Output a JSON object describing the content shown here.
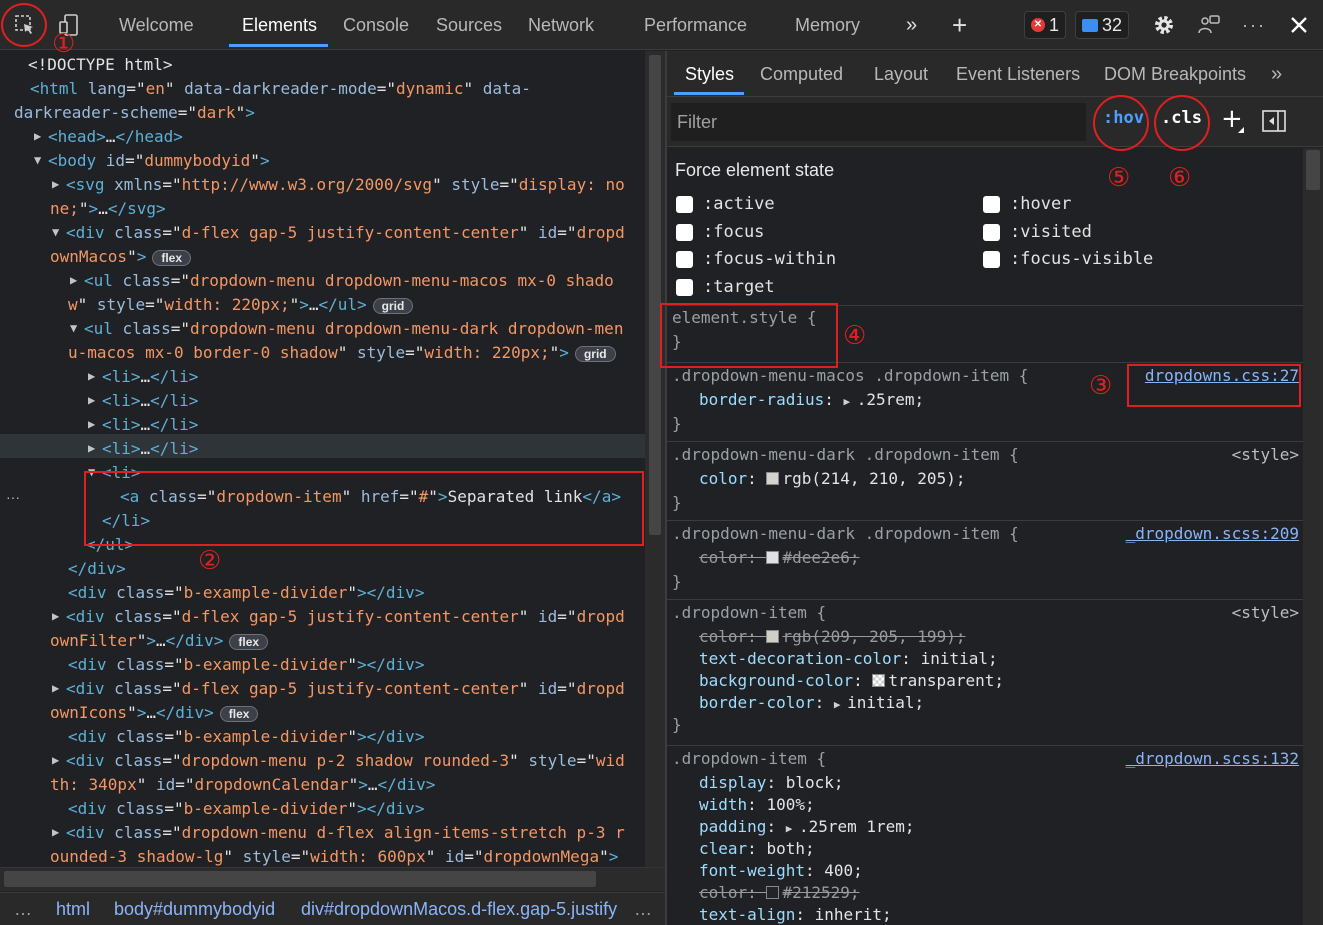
{
  "toolbar": {
    "tabs": [
      "Welcome",
      "Elements",
      "Console",
      "Sources",
      "Network",
      "Performance",
      "Memory"
    ],
    "active_tab": "Elements",
    "more_tabs": "»",
    "add_tab": "+",
    "errors_count": "1",
    "messages_count": "32",
    "icons": [
      "inspect-element-icon",
      "device-emulation-icon",
      "more-tabs-icon",
      "plus-icon",
      "error-icon",
      "message-icon",
      "gear-icon",
      "feedback-icon",
      "more-options-icon",
      "close-icon"
    ]
  },
  "dom_tree": {
    "lines": [
      {
        "indent": 28,
        "tri": "",
        "html": "<!DOCTYPE html>"
      },
      {
        "indent": 30,
        "tri": "",
        "parts": [
          [
            "tg",
            "<html "
          ],
          [
            "an",
            "lang"
          ],
          [
            "tx",
            "=\""
          ],
          [
            "av",
            "en"
          ],
          [
            "tx",
            "\" "
          ],
          [
            "an",
            "data-darkreader-mode"
          ],
          [
            "tx",
            "=\""
          ],
          [
            "av",
            "dynamic"
          ],
          [
            "tx",
            "\" "
          ],
          [
            "an",
            "data-"
          ]
        ]
      },
      {
        "indent": 14,
        "tri": "",
        "parts": [
          [
            "an",
            "darkreader-scheme"
          ],
          [
            "tx",
            "=\""
          ],
          [
            "av",
            "dark"
          ],
          [
            "tx",
            "\""
          ],
          [
            "tg",
            ">"
          ]
        ]
      },
      {
        "indent": 48,
        "tri": "▶",
        "parts": [
          [
            "tg",
            "<head>"
          ],
          [
            "tx",
            "…"
          ],
          [
            "tg",
            "</head>"
          ]
        ]
      },
      {
        "indent": 48,
        "tri": "▼",
        "parts": [
          [
            "tg",
            "<body "
          ],
          [
            "an",
            "id"
          ],
          [
            "tx",
            "=\""
          ],
          [
            "av",
            "dummybodyid"
          ],
          [
            "tx",
            "\""
          ],
          [
            "tg",
            ">"
          ]
        ]
      },
      {
        "indent": 66,
        "tri": "▶",
        "parts": [
          [
            "tg",
            "<svg "
          ],
          [
            "an",
            "xmlns"
          ],
          [
            "tx",
            "=\""
          ],
          [
            "av",
            "http://www.w3.org/2000/svg"
          ],
          [
            "tx",
            "\" "
          ],
          [
            "an",
            "style"
          ],
          [
            "tx",
            "=\""
          ],
          [
            "av",
            "display: no"
          ]
        ]
      },
      {
        "indent": 50,
        "tri": "",
        "parts": [
          [
            "av",
            "ne;"
          ],
          [
            "tx",
            "\""
          ],
          [
            "tg",
            ">"
          ],
          [
            "tx",
            "…"
          ],
          [
            "tg",
            "</svg>"
          ]
        ]
      },
      {
        "indent": 66,
        "tri": "▼",
        "parts": [
          [
            "tg",
            "<div "
          ],
          [
            "an",
            "class"
          ],
          [
            "tx",
            "=\""
          ],
          [
            "av",
            "d-flex gap-5 justify-content-center"
          ],
          [
            "tx",
            "\" "
          ],
          [
            "an",
            "id"
          ],
          [
            "tx",
            "=\""
          ],
          [
            "av",
            "dropd"
          ]
        ]
      },
      {
        "indent": 50,
        "tri": "",
        "parts": [
          [
            "av",
            "ownMacos"
          ],
          [
            "tx",
            "\""
          ],
          [
            "tg",
            ">"
          ]
        ],
        "chip": "flex"
      },
      {
        "indent": 84,
        "tri": "▶",
        "parts": [
          [
            "tg",
            "<ul "
          ],
          [
            "an",
            "class"
          ],
          [
            "tx",
            "=\""
          ],
          [
            "av",
            "dropdown-menu dropdown-menu-macos mx-0 shado"
          ]
        ]
      },
      {
        "indent": 68,
        "tri": "",
        "parts": [
          [
            "av",
            "w"
          ],
          [
            "tx",
            "\" "
          ],
          [
            "an",
            "style"
          ],
          [
            "tx",
            "=\""
          ],
          [
            "av",
            "width: 220px;"
          ],
          [
            "tx",
            "\""
          ],
          [
            "tg",
            ">"
          ],
          [
            "tx",
            "…"
          ],
          [
            "tg",
            "</ul>"
          ]
        ],
        "chip": "grid"
      },
      {
        "indent": 84,
        "tri": "▼",
        "parts": [
          [
            "tg",
            "<ul "
          ],
          [
            "an",
            "class"
          ],
          [
            "tx",
            "=\""
          ],
          [
            "av",
            "dropdown-menu dropdown-menu-dark dropdown-men"
          ]
        ]
      },
      {
        "indent": 68,
        "tri": "",
        "parts": [
          [
            "av",
            "u-macos mx-0 border-0 shadow"
          ],
          [
            "tx",
            "\" "
          ],
          [
            "an",
            "style"
          ],
          [
            "tx",
            "=\""
          ],
          [
            "av",
            "width: 220px;"
          ],
          [
            "tx",
            "\""
          ],
          [
            "tg",
            ">"
          ]
        ],
        "chip": "grid"
      },
      {
        "indent": 102,
        "tri": "▶",
        "parts": [
          [
            "tg",
            "<li>"
          ],
          [
            "tx",
            "…"
          ],
          [
            "tg",
            "</li>"
          ]
        ]
      },
      {
        "indent": 102,
        "tri": "▶",
        "parts": [
          [
            "tg",
            "<li>"
          ],
          [
            "tx",
            "…"
          ],
          [
            "tg",
            "</li>"
          ]
        ]
      },
      {
        "indent": 102,
        "tri": "▶",
        "parts": [
          [
            "tg",
            "<li>"
          ],
          [
            "tx",
            "…"
          ],
          [
            "tg",
            "</li>"
          ]
        ]
      },
      {
        "indent": 102,
        "tri": "▶",
        "parts": [
          [
            "tg",
            "<li>"
          ],
          [
            "tx",
            "…"
          ],
          [
            "tg",
            "</li>"
          ]
        ]
      },
      {
        "indent": 102,
        "tri": "▼",
        "parts": [
          [
            "tg",
            "<li>"
          ]
        ]
      },
      {
        "indent": 120,
        "tri": "",
        "parts": [
          [
            "tg",
            "<a "
          ],
          [
            "an",
            "class"
          ],
          [
            "tx",
            "=\""
          ],
          [
            "av",
            "dropdown-item"
          ],
          [
            "tx",
            "\" "
          ],
          [
            "an",
            "href"
          ],
          [
            "tx",
            "=\""
          ],
          [
            "av",
            "#"
          ],
          [
            "tx",
            "\""
          ],
          [
            "tg",
            ">"
          ],
          [
            "tx",
            "Separated link"
          ],
          [
            "tg",
            "</a>"
          ]
        ],
        "selected": true
      },
      {
        "indent": 102,
        "tri": "",
        "parts": [
          [
            "tg",
            "</li>"
          ]
        ]
      },
      {
        "indent": 86,
        "tri": "",
        "parts": [
          [
            "tg",
            "</ul>"
          ]
        ]
      },
      {
        "indent": 68,
        "tri": "",
        "parts": [
          [
            "tg",
            "</div>"
          ]
        ]
      },
      {
        "indent": 68,
        "tri": "",
        "parts": [
          [
            "tg",
            "<div "
          ],
          [
            "an",
            "class"
          ],
          [
            "tx",
            "=\""
          ],
          [
            "av",
            "b-example-divider"
          ],
          [
            "tx",
            "\""
          ],
          [
            "tg",
            "></div>"
          ]
        ]
      },
      {
        "indent": 66,
        "tri": "▶",
        "parts": [
          [
            "tg",
            "<div "
          ],
          [
            "an",
            "class"
          ],
          [
            "tx",
            "=\""
          ],
          [
            "av",
            "d-flex gap-5 justify-content-center"
          ],
          [
            "tx",
            "\" "
          ],
          [
            "an",
            "id"
          ],
          [
            "tx",
            "=\""
          ],
          [
            "av",
            "dropd"
          ]
        ]
      },
      {
        "indent": 50,
        "tri": "",
        "parts": [
          [
            "av",
            "ownFilter"
          ],
          [
            "tx",
            "\""
          ],
          [
            "tg",
            ">"
          ],
          [
            "tx",
            "…"
          ],
          [
            "tg",
            "</div>"
          ]
        ],
        "chip": "flex"
      },
      {
        "indent": 68,
        "tri": "",
        "parts": [
          [
            "tg",
            "<div "
          ],
          [
            "an",
            "class"
          ],
          [
            "tx",
            "=\""
          ],
          [
            "av",
            "b-example-divider"
          ],
          [
            "tx",
            "\""
          ],
          [
            "tg",
            "></div>"
          ]
        ]
      },
      {
        "indent": 66,
        "tri": "▶",
        "parts": [
          [
            "tg",
            "<div "
          ],
          [
            "an",
            "class"
          ],
          [
            "tx",
            "=\""
          ],
          [
            "av",
            "d-flex gap-5 justify-content-center"
          ],
          [
            "tx",
            "\" "
          ],
          [
            "an",
            "id"
          ],
          [
            "tx",
            "=\""
          ],
          [
            "av",
            "dropd"
          ]
        ]
      },
      {
        "indent": 50,
        "tri": "",
        "parts": [
          [
            "av",
            "ownIcons"
          ],
          [
            "tx",
            "\""
          ],
          [
            "tg",
            ">"
          ],
          [
            "tx",
            "…"
          ],
          [
            "tg",
            "</div>"
          ]
        ],
        "chip": "flex"
      },
      {
        "indent": 68,
        "tri": "",
        "parts": [
          [
            "tg",
            "<div "
          ],
          [
            "an",
            "class"
          ],
          [
            "tx",
            "=\""
          ],
          [
            "av",
            "b-example-divider"
          ],
          [
            "tx",
            "\""
          ],
          [
            "tg",
            "></div>"
          ]
        ]
      },
      {
        "indent": 66,
        "tri": "▶",
        "parts": [
          [
            "tg",
            "<div "
          ],
          [
            "an",
            "class"
          ],
          [
            "tx",
            "=\""
          ],
          [
            "av",
            "dropdown-menu p-2 shadow rounded-3"
          ],
          [
            "tx",
            "\" "
          ],
          [
            "an",
            "style"
          ],
          [
            "tx",
            "=\""
          ],
          [
            "av",
            "wid"
          ]
        ]
      },
      {
        "indent": 50,
        "tri": "",
        "parts": [
          [
            "av",
            "th: 340px"
          ],
          [
            "tx",
            "\" "
          ],
          [
            "an",
            "id"
          ],
          [
            "tx",
            "=\""
          ],
          [
            "av",
            "dropdownCalendar"
          ],
          [
            "tx",
            "\""
          ],
          [
            "tg",
            ">"
          ],
          [
            "tx",
            "…"
          ],
          [
            "tg",
            "</div>"
          ]
        ]
      },
      {
        "indent": 68,
        "tri": "",
        "parts": [
          [
            "tg",
            "<div "
          ],
          [
            "an",
            "class"
          ],
          [
            "tx",
            "=\""
          ],
          [
            "av",
            "b-example-divider"
          ],
          [
            "tx",
            "\""
          ],
          [
            "tg",
            "></div>"
          ]
        ]
      },
      {
        "indent": 66,
        "tri": "▶",
        "parts": [
          [
            "tg",
            "<div "
          ],
          [
            "an",
            "class"
          ],
          [
            "tx",
            "=\""
          ],
          [
            "av",
            "dropdown-menu d-flex align-items-stretch p-3 r"
          ]
        ]
      },
      {
        "indent": 50,
        "tri": "",
        "parts": [
          [
            "av",
            "ounded-3 shadow-lg"
          ],
          [
            "tx",
            "\" "
          ],
          [
            "an",
            "style"
          ],
          [
            "tx",
            "=\""
          ],
          [
            "av",
            "width: 600px"
          ],
          [
            "tx",
            "\" "
          ],
          [
            "an",
            "id"
          ],
          [
            "tx",
            "=\""
          ],
          [
            "av",
            "dropdownMega"
          ],
          [
            "tx",
            "\""
          ],
          [
            "tg",
            ">"
          ]
        ]
      }
    ],
    "row_dots": "···"
  },
  "breadcrumb": {
    "leading": "…",
    "items": [
      "html",
      "body#dummybodyid",
      "div#dropdownMacos.d-flex.gap-5.justify"
    ],
    "trailing": "…"
  },
  "styles_tabs": {
    "items": [
      "Styles",
      "Computed",
      "Layout",
      "Event Listeners",
      "DOM Breakpoints"
    ],
    "more": "»"
  },
  "filter": {
    "placeholder": "Filter",
    "hov": ":hov",
    "cls": ".cls",
    "new_rule": "+"
  },
  "force_state": {
    "title": "Force element state",
    "left": [
      ":active",
      ":focus",
      ":focus-within",
      ":target"
    ],
    "right": [
      ":hover",
      ":visited",
      ":focus-visible"
    ]
  },
  "rules": [
    {
      "selector": "element.style {",
      "close": "}",
      "source": "",
      "decls": []
    },
    {
      "selector": ".dropdown-menu-macos .dropdown-item {",
      "source": "dropdowns.css:27",
      "source_link": true,
      "decls": [
        {
          "p": "border-radius",
          "v": ".25rem;",
          "tri": true
        }
      ]
    },
    {
      "selector": ".dropdown-menu-dark .dropdown-item {",
      "source": "<style>",
      "source_link": false,
      "decls": [
        {
          "p": "color",
          "v": "rgb(214, 210, 205);",
          "swatch": "#d6d2cd"
        }
      ]
    },
    {
      "selector": ".dropdown-menu-dark .dropdown-item {",
      "source": "_dropdown.scss:209",
      "source_link": true,
      "decls": [
        {
          "p": "color",
          "v": "#dee2e6;",
          "swatch": "#dee2e6",
          "struck": true
        }
      ]
    },
    {
      "selector": ".dropdown-item {",
      "source": "<style>",
      "source_link": false,
      "decls": [
        {
          "p": "color",
          "v": "rgb(209, 205, 199);",
          "swatch": "#d1cdc7",
          "struck": true
        },
        {
          "p": "text-decoration-color",
          "v": "initial;"
        },
        {
          "p": "background-color",
          "v": "transparent;",
          "swatch": "checker"
        },
        {
          "p": "border-color",
          "v": "initial;",
          "tri": true
        }
      ]
    },
    {
      "selector": ".dropdown-item {",
      "source": "_dropdown.scss:132",
      "source_link": true,
      "decls": [
        {
          "p": "display",
          "v": "block;"
        },
        {
          "p": "width",
          "v": "100%;"
        },
        {
          "p": "padding",
          "v": ".25rem 1rem;",
          "tri": true
        },
        {
          "p": "clear",
          "v": "both;"
        },
        {
          "p": "font-weight",
          "v": "400;"
        },
        {
          "p": "color",
          "v": "#212529;",
          "swatch": "#212529",
          "struck": true
        },
        {
          "p": "text-align",
          "v": "inherit;"
        }
      ]
    }
  ],
  "annotations": [
    "①",
    "②",
    "③",
    "④",
    "⑤",
    "⑥"
  ],
  "colors": {
    "accent": "#4c9fff",
    "annotation": "#e02020",
    "tag": "#5db0d7",
    "attr_name": "#9bbbdc",
    "attr_value": "#f29766"
  }
}
